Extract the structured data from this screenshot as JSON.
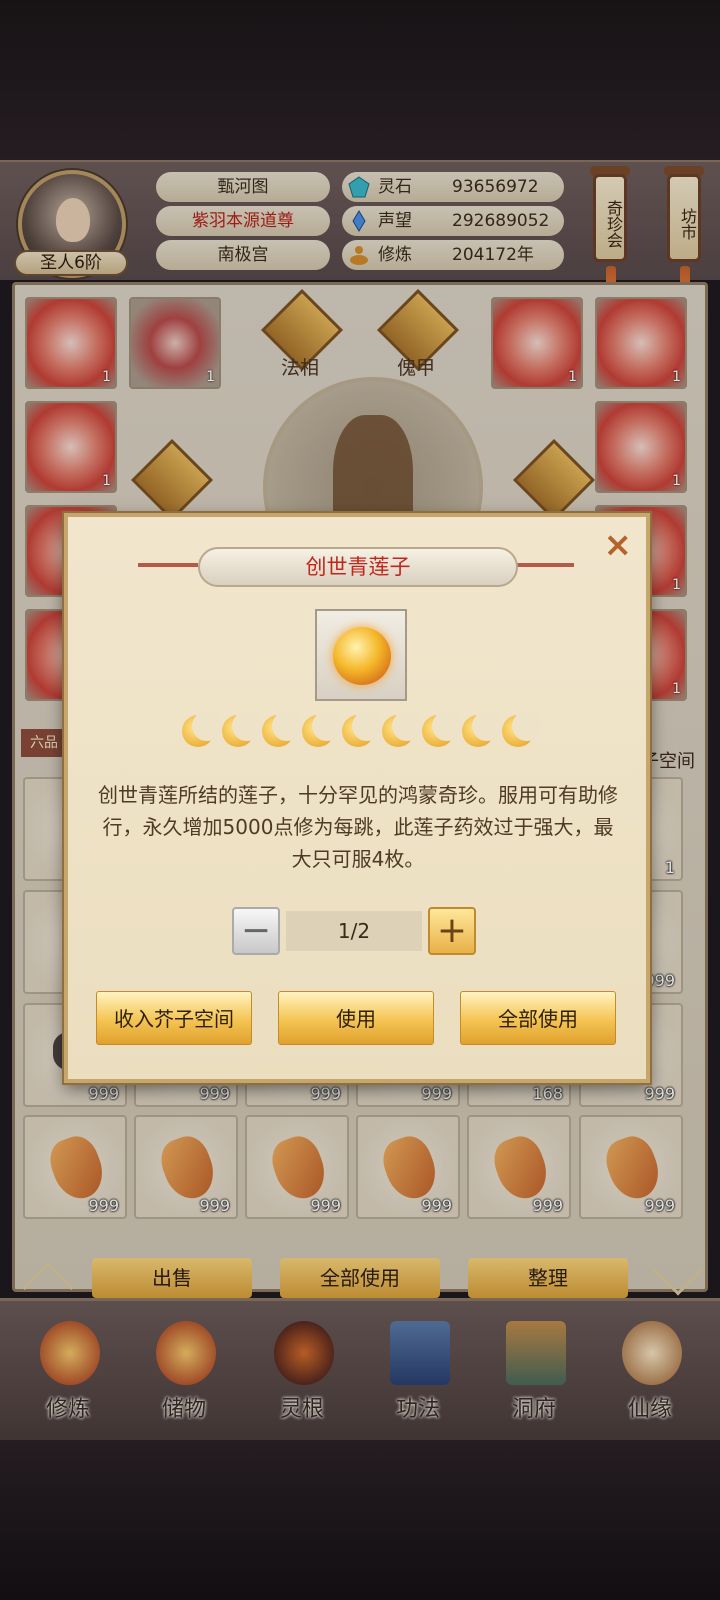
{
  "header": {
    "rank": "圣人6阶",
    "names": [
      "甄河图",
      "紫羽本源道尊",
      "南极宫"
    ],
    "stats": [
      {
        "label": "灵石",
        "value": "93656972",
        "icon": "spirit-stone-icon"
      },
      {
        "label": "声望",
        "value": "292689052",
        "icon": "prestige-crystal-icon"
      },
      {
        "label": "修炼",
        "value": "204172年",
        "icon": "meditation-icon"
      }
    ],
    "side_buttons": [
      "奇珍会",
      "坊市"
    ]
  },
  "equipment": {
    "labels": [
      "法相",
      "傀甲"
    ],
    "slot_counts": [
      "1",
      "1",
      "1",
      "1",
      "1",
      "1",
      "1",
      "1"
    ]
  },
  "partial_text": {
    "left_tag": "六品",
    "right_tag": "子空间"
  },
  "inventory": {
    "row3_counts": [
      "999",
      "999",
      "999",
      "999",
      "168",
      "999"
    ],
    "row4_counts": [
      "999",
      "999",
      "999",
      "999",
      "999",
      "999"
    ],
    "right_counts": [
      "1",
      "999",
      "999"
    ]
  },
  "bottom_buttons": [
    "出售",
    "全部使用",
    "整理"
  ],
  "nav": [
    "修炼",
    "储物",
    "灵根",
    "功法",
    "洞府",
    "仙缘"
  ],
  "dialog": {
    "title": "创世青莲子",
    "quality_moons": 9,
    "description": "创世青莲所结的莲子，十分罕见的鸿蒙奇珍。服用可有助修行，永久增加5000点修为每跳，此莲子药效过于强大，最大只可服4枚。",
    "quantity": "1/2",
    "minus": "−",
    "plus": "+",
    "buttons": [
      "收入芥子空间",
      "使用",
      "全部使用"
    ],
    "close": "×"
  }
}
